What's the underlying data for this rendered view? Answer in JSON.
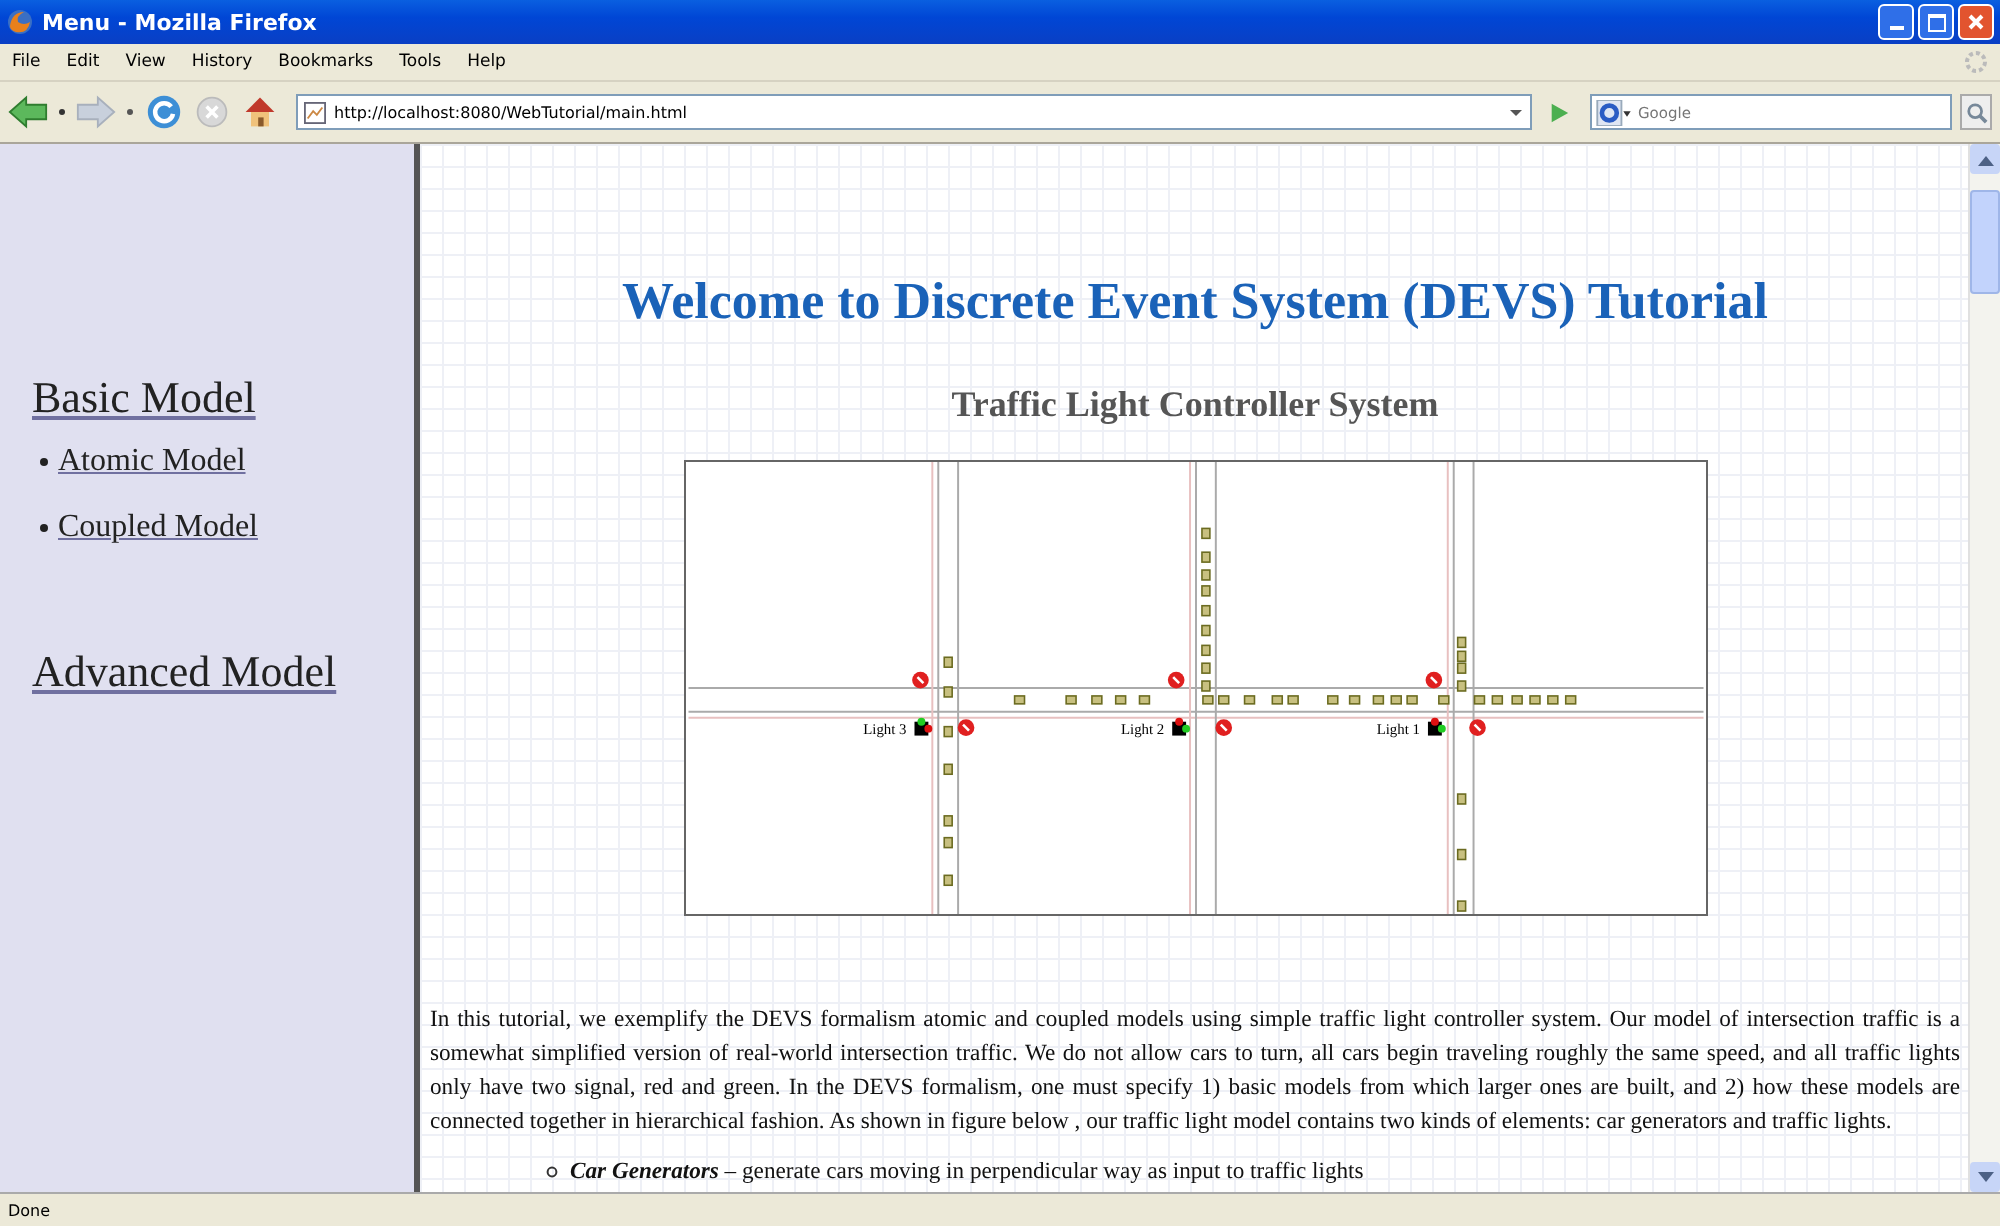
{
  "window": {
    "title": "Menu - Mozilla Firefox"
  },
  "menu": [
    "File",
    "Edit",
    "View",
    "History",
    "Bookmarks",
    "Tools",
    "Help"
  ],
  "toolbar": {
    "url": "http://localhost:8080/WebTutorial/main.html",
    "search_placeholder": "Google"
  },
  "sidebar": {
    "sections": [
      {
        "title": "Basic Model",
        "items": [
          "Atomic Model",
          "Coupled Model"
        ]
      },
      {
        "title": "Advanced Model"
      }
    ]
  },
  "page": {
    "title": "Welcome to Discrete Event System (DEVS) Tutorial",
    "subtitle": "Traffic Light Controller System",
    "diagram": {
      "lights": [
        {
          "label": "Light 3",
          "north_green": true
        },
        {
          "label": "Light 2",
          "north_green": false
        },
        {
          "label": "Light 1",
          "north_green": false
        }
      ]
    },
    "paragraph": "In this tutorial, we exemplify the DEVS formalism atomic and coupled models using simple traffic light controller system. Our model of intersection traffic is a somewhat simplified version of real-world intersection traffic. We do not allow cars to turn, all cars begin traveling roughly the same speed, and all traffic lights only have two signal, red and green. In the DEVS formalism, one must specify 1) basic models from which larger ones are built, and 2) how these models are connected together in hierarchical fashion. As shown in figure below , our traffic light model contains two kinds of elements: car generators and traffic lights.",
    "bullets": [
      "**Car Generators** – generate cars moving in perpendicular way as input to traffic lights"
    ]
  },
  "status_bar": "Done"
}
